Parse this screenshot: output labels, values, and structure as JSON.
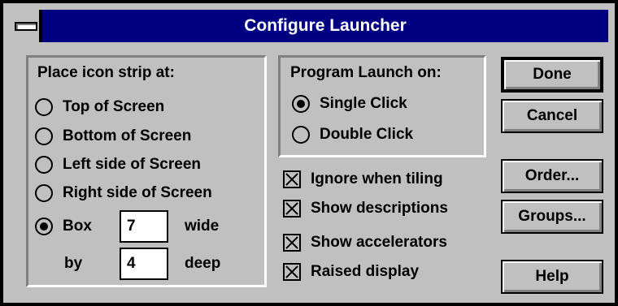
{
  "window": {
    "title": "Configure Launcher"
  },
  "icon_strip": {
    "heading": "Place icon strip at:",
    "options": [
      {
        "label": "Top of Screen",
        "checked": false
      },
      {
        "label": "Bottom of Screen",
        "checked": false
      },
      {
        "label": "Left side of Screen",
        "checked": false
      },
      {
        "label": "Right side of Screen",
        "checked": false
      },
      {
        "label": "Box",
        "checked": true
      }
    ],
    "box": {
      "wide_value": "7",
      "wide_label": "wide",
      "by_label": "by",
      "deep_value": "4",
      "deep_label": "deep"
    }
  },
  "launch": {
    "heading": "Program Launch on:",
    "options": [
      {
        "label": "Single Click",
        "checked": true
      },
      {
        "label": "Double Click",
        "checked": false
      }
    ]
  },
  "checkboxes": [
    {
      "label": "Ignore when tiling",
      "checked": true
    },
    {
      "label": "Show descriptions",
      "checked": true
    },
    {
      "label": "Show accelerators",
      "checked": true
    },
    {
      "label": "Raised display",
      "checked": true
    }
  ],
  "buttons": {
    "done": "Done",
    "cancel": "Cancel",
    "order": "Order...",
    "groups": "Groups...",
    "help": "Help"
  },
  "colors": {
    "titlebar": "#000080",
    "face": "#c0c0c0"
  }
}
